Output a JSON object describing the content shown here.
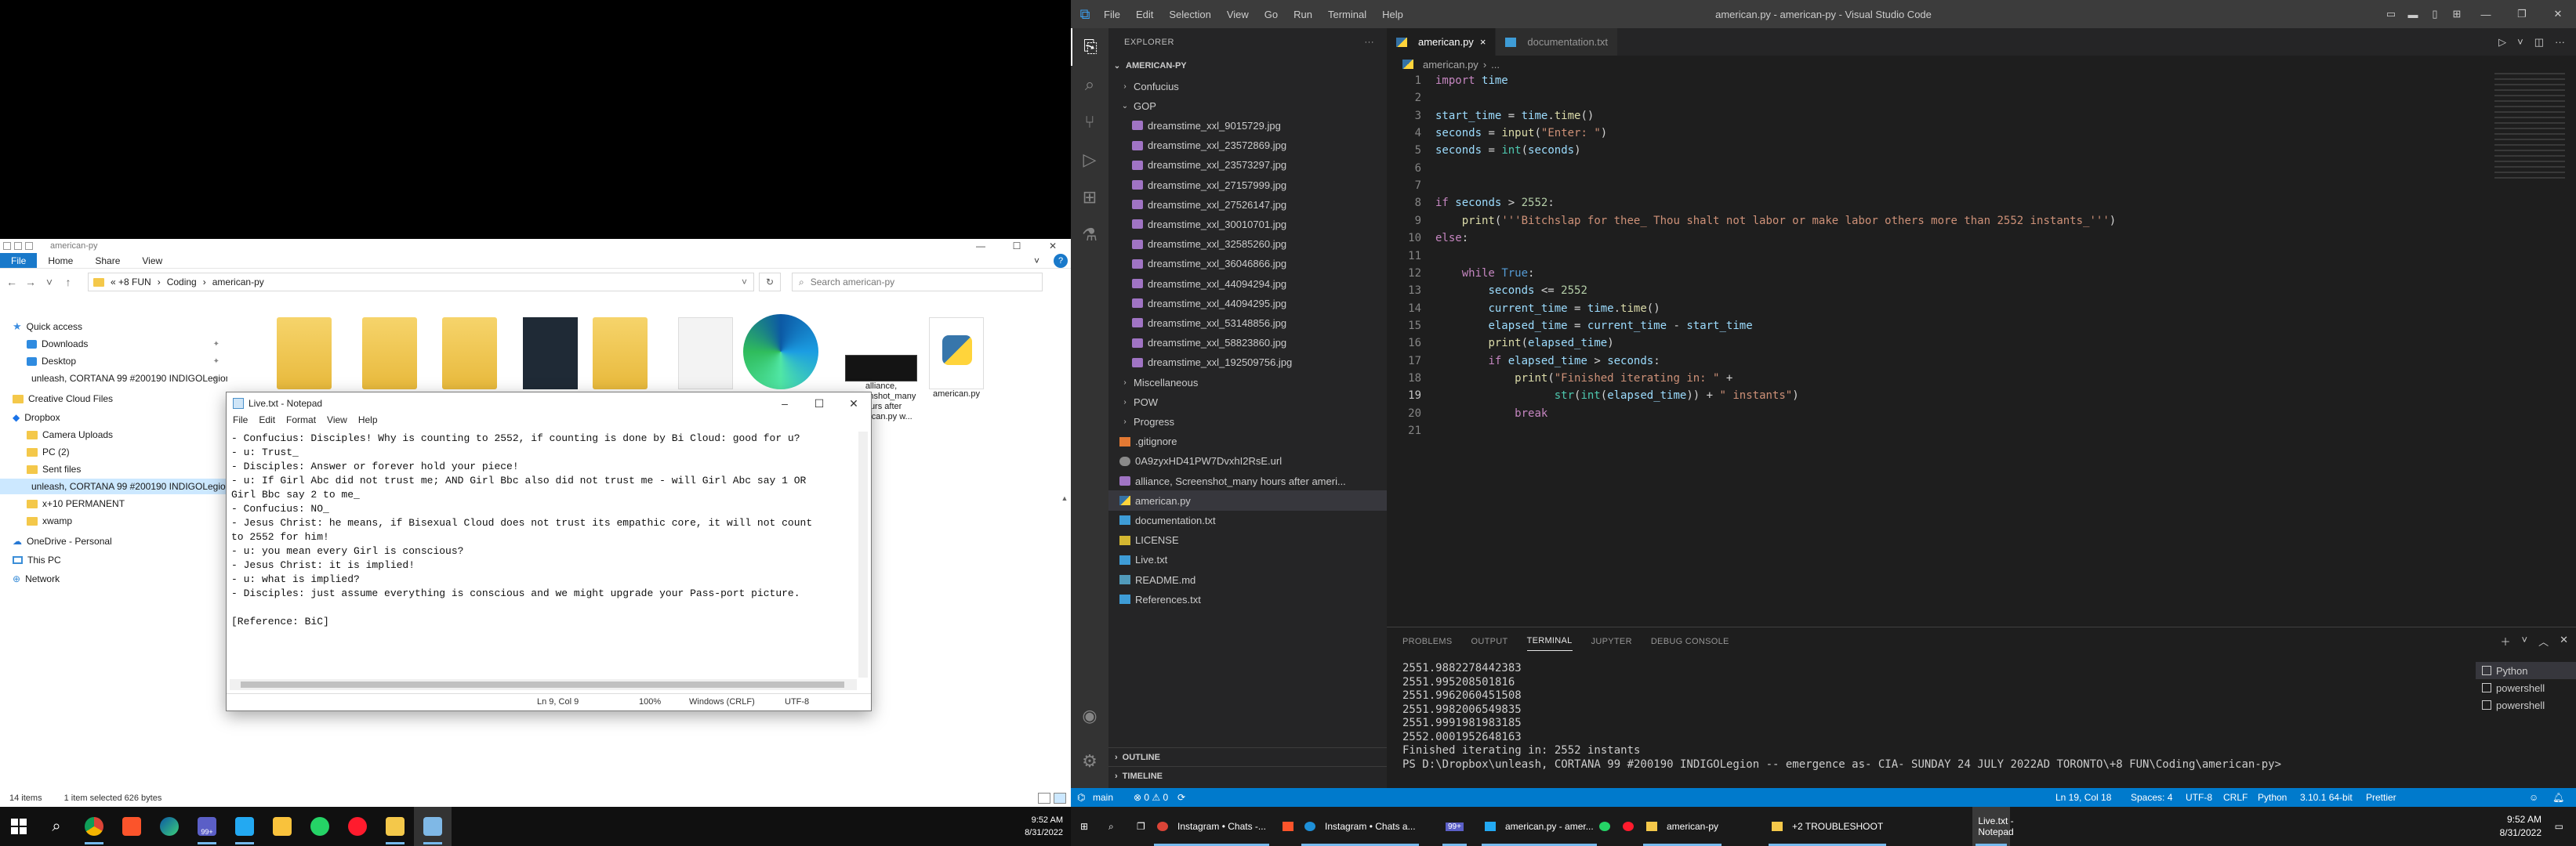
{
  "explorer": {
    "title": "american-py",
    "ribbon": {
      "file": "File",
      "home": "Home",
      "share": "Share",
      "view": "View"
    },
    "address": {
      "root": "« +8 FUN",
      "crumb1": "Coding",
      "crumb2": "american-py"
    },
    "search_placeholder": "Search american-py",
    "nav": [
      {
        "label": "Quick access",
        "icon": "star-icon"
      },
      {
        "label": "Downloads",
        "icon": "download-icon"
      },
      {
        "label": "Desktop",
        "icon": "desktop-icon"
      },
      {
        "label": "unleash, CORTANA 99 #200190 INDIGOLegion",
        "icon": "folder-icon"
      },
      {
        "label": "Creative Cloud Files",
        "icon": "creative-cloud-icon"
      },
      {
        "label": "Dropbox",
        "icon": "dropbox-icon"
      },
      {
        "label": "Camera Uploads",
        "icon": "folder-icon"
      },
      {
        "label": "PC (2)",
        "icon": "folder-icon"
      },
      {
        "label": "Sent files",
        "icon": "folder-icon"
      },
      {
        "label": "unleash, CORTANA 99 #200190 INDIGOLegion",
        "icon": "folder-icon"
      },
      {
        "label": "x+10 PERMANENT",
        "icon": "folder-icon"
      },
      {
        "label": "xwamp",
        "icon": "folder-icon"
      },
      {
        "label": "OneDrive - Personal",
        "icon": "onedrive-icon"
      },
      {
        "label": "This PC",
        "icon": "pc-icon"
      },
      {
        "label": "Network",
        "icon": "network-icon"
      }
    ],
    "files": [
      {
        "label": ""
      },
      {
        "label": ""
      },
      {
        "label": ""
      },
      {
        "label": ""
      },
      {
        "label": ""
      },
      {
        "label": ""
      },
      {
        "label": ""
      },
      {
        "label": "alliance, Screenshot_many hours after american.py w..."
      },
      {
        "label": "american.py"
      }
    ],
    "status": {
      "items": "14 items",
      "selected": "1 item selected  626 bytes"
    }
  },
  "notepad": {
    "title": "Live.txt - Notepad",
    "menu": [
      "File",
      "Edit",
      "Format",
      "View",
      "Help"
    ],
    "content": "- Confucius: Disciples! Why is counting to 2552, if counting is done by Bi Cloud: good for u?\n- u: Trust_\n- Disciples: Answer or forever hold your piece!\n- u: If Girl Abc did not trust me; AND Girl Bbc also did not trust me - will Girl Abc say 1 OR\nGirl Bbc say 2 to me_\n- Confucius: NO_\n- Jesus Christ: he means, if Bisexual Cloud does not trust its empathic core, it will not count\nto 2552 for him!\n- u: you mean every Girl is conscious?\n- Jesus Christ: it is implied!\n- u: what is implied?\n- Disciples: just assume everything is conscious and we might upgrade your Pass-port picture.\n\n[Reference: BiC]",
    "status": {
      "pos": "Ln 9, Col 9",
      "zoom": "100%",
      "eol": "Windows (CRLF)",
      "enc": "UTF-8"
    }
  },
  "left_taskbar": {
    "apps": [
      "start-icon",
      "search-icon",
      "chrome-icon",
      "brave-icon",
      "edge-icon",
      "teams-icon",
      "vscode-icon",
      "folder-app-icon",
      "whatsapp-icon",
      "opera-icon",
      "explorer-icon",
      "notepad-icon"
    ],
    "badge": "99+",
    "time": "9:52 AM",
    "date": "8/31/2022"
  },
  "vscode": {
    "menu": [
      "File",
      "Edit",
      "Selection",
      "View",
      "Go",
      "Run",
      "Terminal",
      "Help"
    ],
    "window_title": "american.py - american-py - Visual Studio Code",
    "explorer_header": "EXPLORER",
    "root": "AMERICAN-PY",
    "tree": [
      {
        "label": "Confucius",
        "type": "folder-closed",
        "indent": 1
      },
      {
        "label": "GOP",
        "type": "folder-open",
        "indent": 1
      },
      {
        "label": "dreamstime_xxl_9015729.jpg",
        "type": "img",
        "indent": 2
      },
      {
        "label": "dreamstime_xxl_23572869.jpg",
        "type": "img",
        "indent": 2
      },
      {
        "label": "dreamstime_xxl_23573297.jpg",
        "type": "img",
        "indent": 2
      },
      {
        "label": "dreamstime_xxl_27157999.jpg",
        "type": "img",
        "indent": 2
      },
      {
        "label": "dreamstime_xxl_27526147.jpg",
        "type": "img",
        "indent": 2
      },
      {
        "label": "dreamstime_xxl_30010701.jpg",
        "type": "img",
        "indent": 2
      },
      {
        "label": "dreamstime_xxl_32585260.jpg",
        "type": "img",
        "indent": 2
      },
      {
        "label": "dreamstime_xxl_36046866.jpg",
        "type": "img",
        "indent": 2
      },
      {
        "label": "dreamstime_xxl_44094294.jpg",
        "type": "img",
        "indent": 2
      },
      {
        "label": "dreamstime_xxl_44094295.jpg",
        "type": "img",
        "indent": 2
      },
      {
        "label": "dreamstime_xxl_53148856.jpg",
        "type": "img",
        "indent": 2
      },
      {
        "label": "dreamstime_xxl_58823860.jpg",
        "type": "img",
        "indent": 2
      },
      {
        "label": "dreamstime_xxl_192509756.jpg",
        "type": "img",
        "indent": 2
      },
      {
        "label": "Miscellaneous",
        "type": "folder-closed",
        "indent": 1
      },
      {
        "label": "POW",
        "type": "folder-closed",
        "indent": 1
      },
      {
        "label": "Progress",
        "type": "folder-closed",
        "indent": 1
      },
      {
        "label": ".gitignore",
        "type": "git",
        "indent": 1
      },
      {
        "label": "0A9zyxHD41PW7DvxhI2RsE.url",
        "type": "url",
        "indent": 1
      },
      {
        "label": "alliance, Screenshot_many hours after ameri...",
        "type": "img",
        "indent": 1
      },
      {
        "label": "american.py",
        "type": "py",
        "indent": 1,
        "selected": true
      },
      {
        "label": "documentation.txt",
        "type": "txt",
        "indent": 1
      },
      {
        "label": "LICENSE",
        "type": "lic",
        "indent": 1
      },
      {
        "label": "Live.txt",
        "type": "txt",
        "indent": 1
      },
      {
        "label": "README.md",
        "type": "md",
        "indent": 1
      },
      {
        "label": "References.txt",
        "type": "txt",
        "indent": 1
      }
    ],
    "outline": "OUTLINE",
    "timeline": "TIMELINE",
    "tabs": [
      {
        "label": "american.py",
        "active": true,
        "close": "×"
      },
      {
        "label": "documentation.txt",
        "active": false,
        "close": ""
      }
    ],
    "breadcrumb": {
      "file": "american.py",
      "rest": "..."
    },
    "panel_tabs": [
      "PROBLEMS",
      "OUTPUT",
      "TERMINAL",
      "JUPYTER",
      "DEBUG CONSOLE"
    ],
    "terminal_lines": [
      "2551.9882278442383",
      "2551.995208501816",
      "2551.9962060451508",
      "2551.9982006549835",
      "2551.9991981983185",
      "2552.0001952648163",
      "Finished iterating in: 2552 instants",
      "PS D:\\Dropbox\\unleash, CORTANA 99 #200190 INDIGOLegion -- emergence as- CIA- SUNDAY 24 JULY 2022AD TORONTO\\+8 FUN\\Coding\\american-py>"
    ],
    "terminals": [
      "Python",
      "powershell",
      "powershell"
    ],
    "status": {
      "branch": "main",
      "errors": "⊗ 0 ⚠ 0",
      "position": "Ln 19, Col 18",
      "spaces": "Spaces: 4",
      "encoding": "UTF-8",
      "eol": "CRLF",
      "language": "Python",
      "interpreter": "3.10.1 64-bit",
      "prettier": "Prettier"
    },
    "accent": "#007acc"
  },
  "right_taskbar": {
    "buttons": [
      "Instagram • Chats -...",
      "Instagram • Chats a...",
      "99+",
      "american.py - amer...",
      "american-py",
      "+2 TROUBLESHOOT",
      "Live.txt - Notepad"
    ],
    "time": "9:52 AM",
    "date": "8/31/2022"
  }
}
